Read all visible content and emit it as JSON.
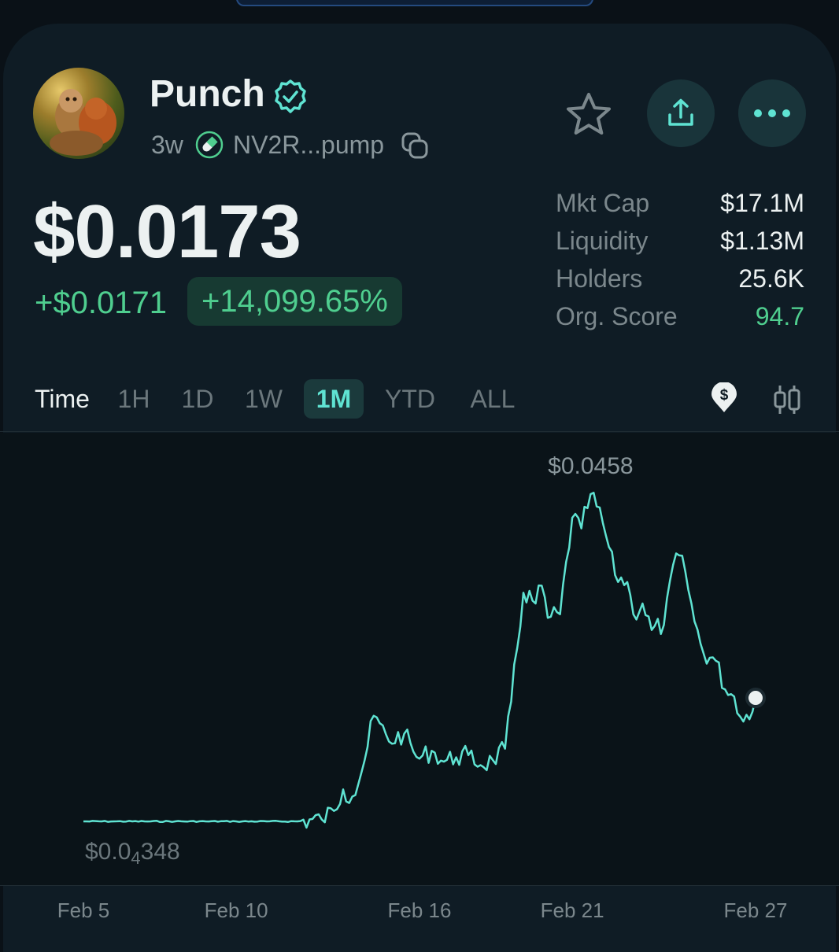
{
  "token": {
    "name": "Punch",
    "age": "3w",
    "address": "NV2R...pump",
    "price": "$0.0173",
    "change_abs": "+$0.0171",
    "change_pct": "+14,099.65%"
  },
  "stats": [
    {
      "label": "Mkt Cap",
      "value": "$17.1M"
    },
    {
      "label": "Liquidity",
      "value": "$1.13M"
    },
    {
      "label": "Holders",
      "value": "25.6K"
    },
    {
      "label": "Org. Score",
      "value": "94.7"
    }
  ],
  "range": {
    "label": "Time",
    "tabs": [
      "1H",
      "1D",
      "1W",
      "1M",
      "YTD",
      "ALL"
    ],
    "selected": "1M"
  },
  "icons": {
    "verified": "verified-badge-icon",
    "pill": "pump-pill-icon",
    "copy": "copy-icon",
    "star": "star-icon",
    "share": "share-icon",
    "more": "more-icon",
    "price_mode": "dollar-icon",
    "candles": "candlestick-icon"
  },
  "colors": {
    "accent": "#5fe3d2",
    "positive": "#4fce8f",
    "background": "#0f1c25"
  },
  "chart_data": {
    "type": "line",
    "max_label": "$0.0458",
    "min_label_prefix": "$0.0",
    "min_label_subscript": "4",
    "min_label_suffix": "348",
    "x_ticks": [
      "Feb 5",
      "Feb 10",
      "Feb 16",
      "Feb 21",
      "Feb 27"
    ],
    "x_tick_positions": [
      0,
      5,
      11,
      16,
      22
    ],
    "ylim": [
      3.48e-05,
      0.0458
    ],
    "series": [
      {
        "x": [
          0,
          1,
          2,
          3,
          4,
          5,
          6,
          7,
          7.8,
          8.2,
          8.5,
          8.8,
          9.2,
          9.5,
          10,
          10.5,
          10.8,
          11,
          11.4,
          11.8,
          12.2,
          12.6,
          13,
          13.4,
          13.8,
          14,
          14.4,
          14.8,
          15,
          15.2,
          15.6,
          16,
          16.3,
          16.6,
          17,
          17.4,
          17.8,
          18,
          18.3,
          18.6,
          19,
          19.4,
          19.7,
          20,
          20.3,
          20.7,
          21,
          21.3,
          21.6,
          22
        ],
        "y": [
          3.48e-05,
          3.48e-05,
          3.48e-05,
          3.48e-05,
          3.48e-05,
          3.48e-05,
          3.48e-05,
          3.48e-05,
          0.0003,
          0.0015,
          0.0045,
          0.0035,
          0.0085,
          0.0148,
          0.0112,
          0.0123,
          0.0098,
          0.0088,
          0.0099,
          0.0084,
          0.009,
          0.0093,
          0.0079,
          0.0086,
          0.0102,
          0.0168,
          0.032,
          0.0305,
          0.033,
          0.0285,
          0.029,
          0.0425,
          0.041,
          0.0458,
          0.0418,
          0.0345,
          0.0335,
          0.029,
          0.0305,
          0.0268,
          0.0275,
          0.0375,
          0.035,
          0.028,
          0.0235,
          0.0225,
          0.0185,
          0.0175,
          0.014,
          0.0173
        ]
      }
    ]
  }
}
